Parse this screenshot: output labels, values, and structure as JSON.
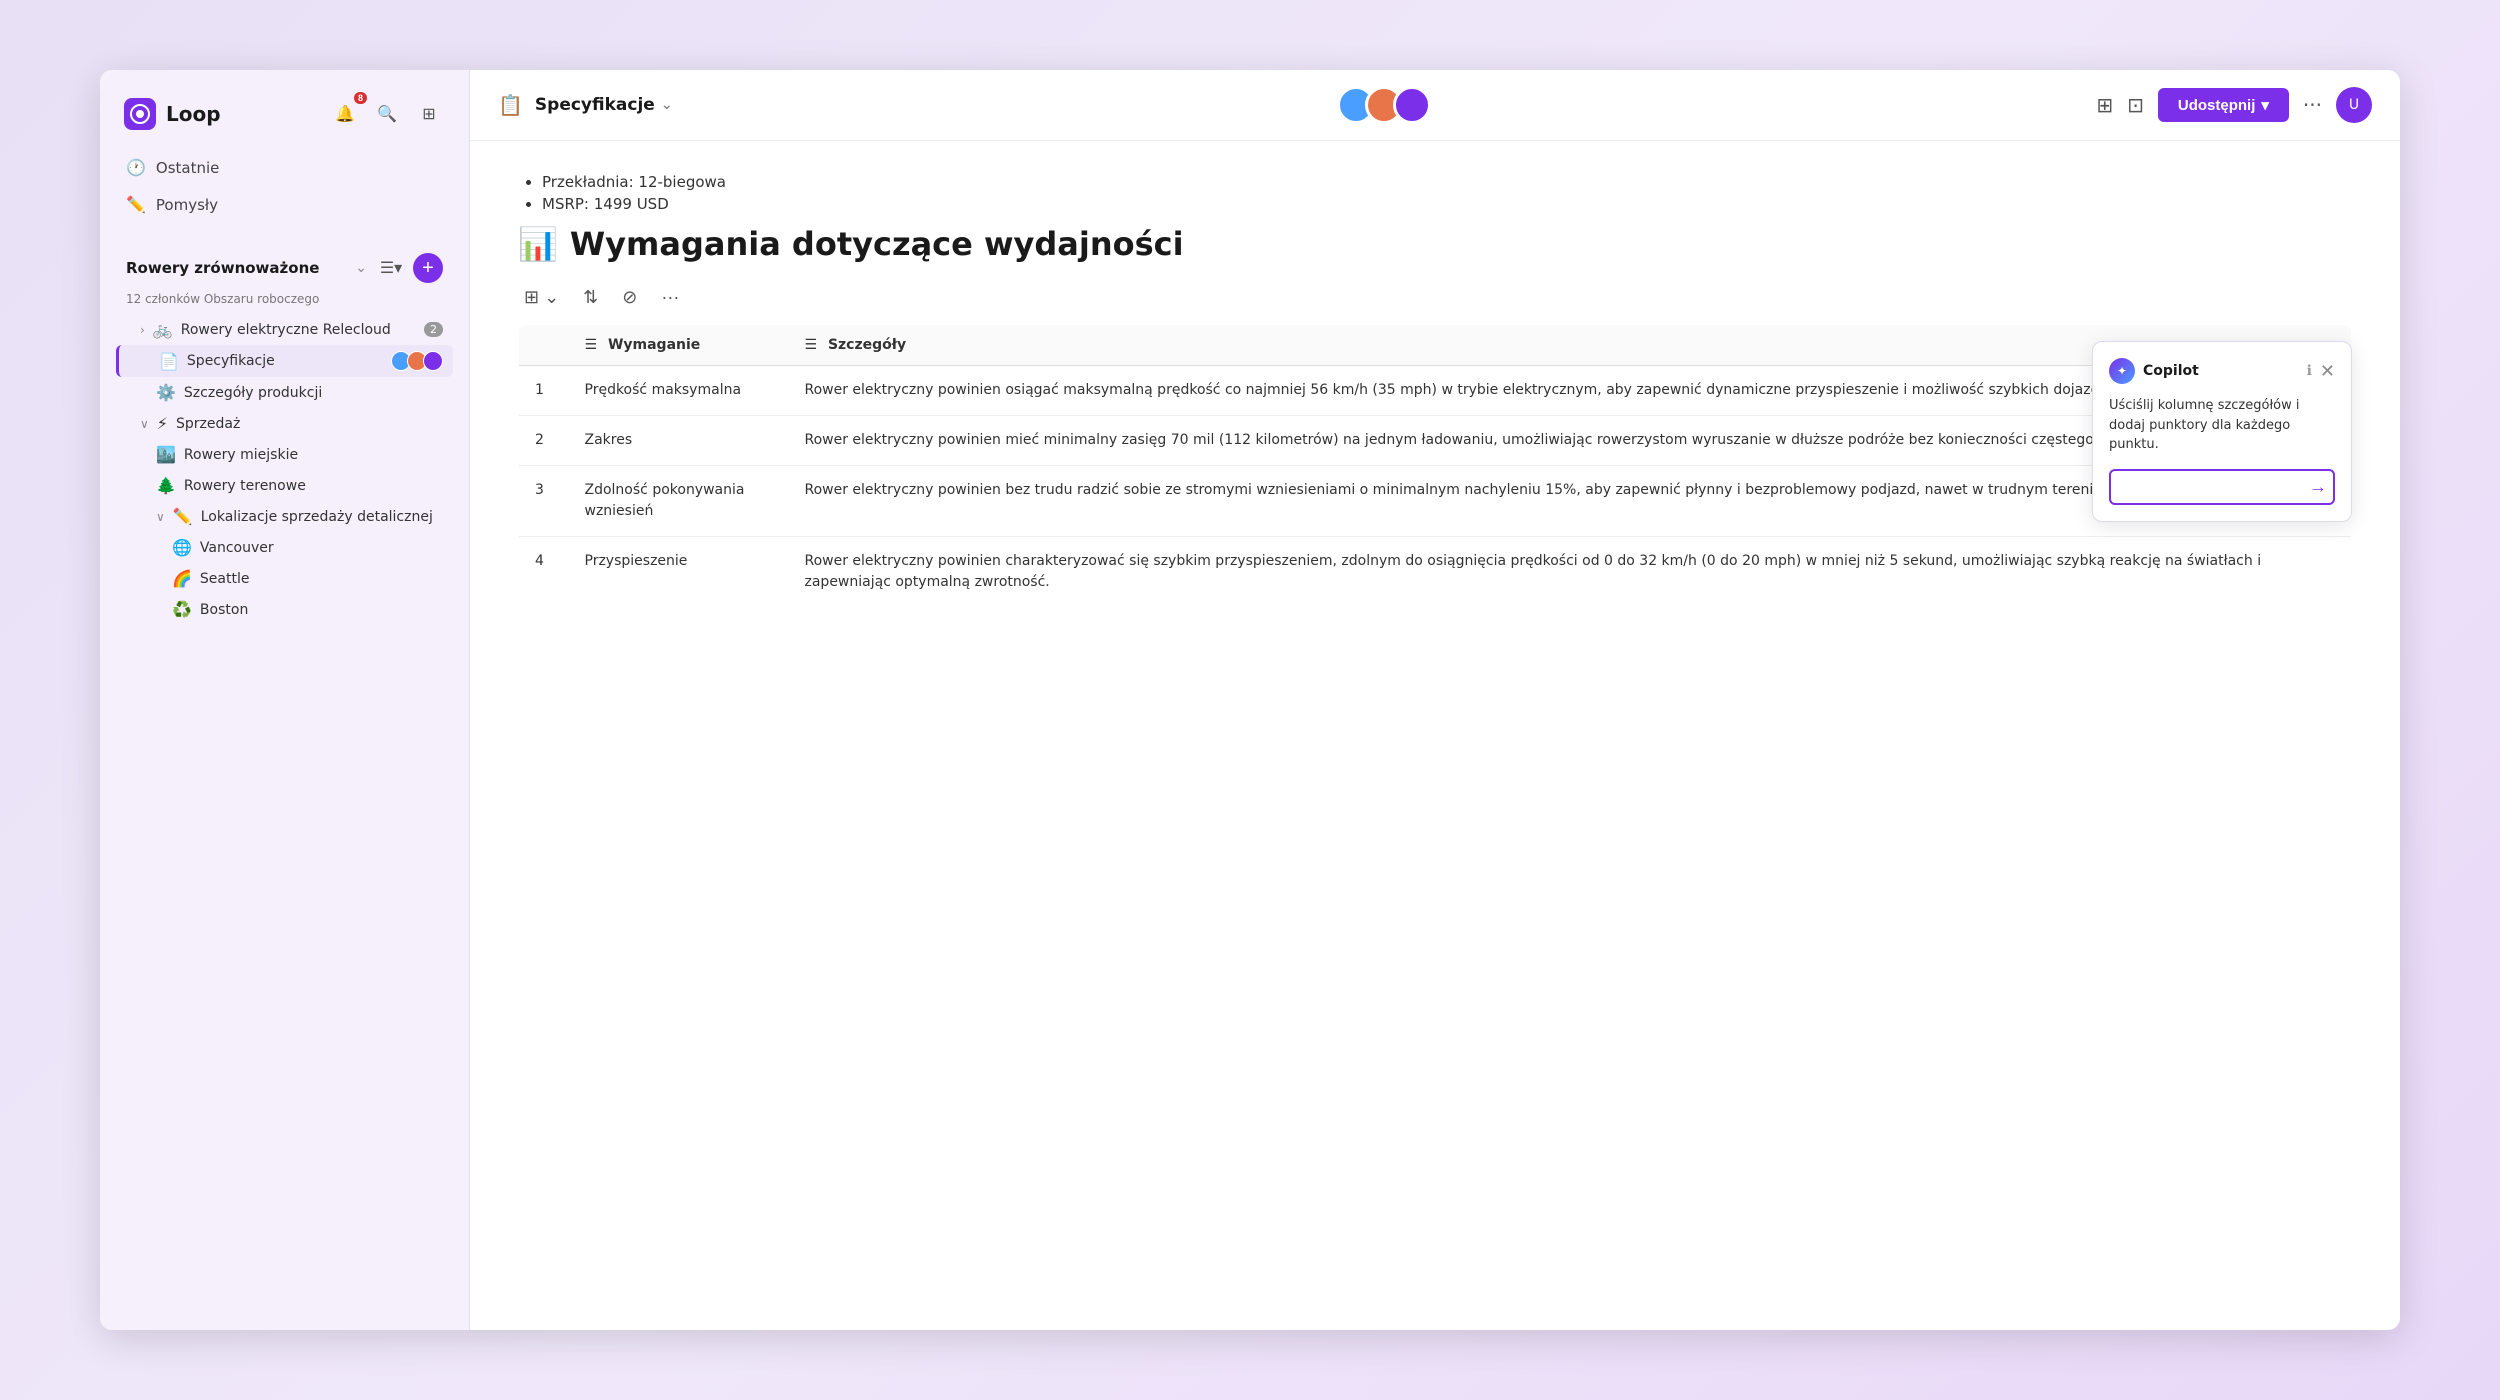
{
  "app": {
    "title": "Loop"
  },
  "sidebar": {
    "workspace": "Rowery zrównoważone",
    "workspace_subtitle": "12 członków Obszaru roboczego",
    "nav_items": [
      {
        "id": "ostatnie",
        "label": "Ostatnie",
        "icon": "🕐"
      },
      {
        "id": "pomysly",
        "label": "Pomysły",
        "icon": "✏️"
      }
    ],
    "tree": [
      {
        "id": "rowery-elektryczne",
        "label": "Rowery elektryczne Relecloud",
        "icon": "🚲",
        "indent": 1,
        "badge": "2",
        "collapsed": false
      },
      {
        "id": "specyfikacje",
        "label": "Specyfikacje",
        "icon": "📄",
        "indent": 2,
        "active": true
      },
      {
        "id": "szczegoly-produkcji",
        "label": "Szczegóły produkcji",
        "icon": "⚙️",
        "indent": 2
      },
      {
        "id": "sprzedaz",
        "label": "Sprzedaż",
        "icon": "⚡",
        "indent": 1,
        "collapsed": false
      },
      {
        "id": "rowery-miejskie",
        "label": "Rowery miejskie",
        "icon": "🏙️",
        "indent": 2
      },
      {
        "id": "rowery-terenowe",
        "label": "Rowery terenowe",
        "icon": "🌲",
        "indent": 2
      },
      {
        "id": "lokalizacje",
        "label": "Lokalizacje sprzedaży detalicznej",
        "icon": "✏️",
        "indent": 2,
        "collapsed": false
      },
      {
        "id": "vancouver",
        "label": "Vancouver",
        "icon": "🌐",
        "indent": 3
      },
      {
        "id": "seattle",
        "label": "Seattle",
        "icon": "🌈",
        "indent": 3
      },
      {
        "id": "boston",
        "label": "Boston",
        "icon": "♻️",
        "indent": 3
      }
    ],
    "plus_btn": "+",
    "bell_count": "8"
  },
  "topbar": {
    "page_icon": "📋",
    "page_title": "Specyfikacje",
    "share_label": "Udostępnij",
    "share_chevron": "▾"
  },
  "doc": {
    "bullets": [
      "Przekładnia: 12-biegowa",
      "MSRP: 1499 USD"
    ],
    "heading_icon": "📊",
    "heading": "Wymagania dotyczące wydajności",
    "table": {
      "cols": [
        "Wymaganie",
        "Szczegóły"
      ],
      "rows": [
        {
          "num": "1",
          "req": "Prędkość maksymalna",
          "detail": "Rower elektryczny powinien osiągać maksymalną prędkość co najmniej 56 km/h (35 mph) w trybie elektrycznym, aby zapewnić dynamiczne przyspieszenie i możliwość szybkich dojazdów do pracy."
        },
        {
          "num": "2",
          "req": "Zakres",
          "detail": "Rower elektryczny powinien mieć minimalny zasięg 70 mil (112 kilometrów) na jednym ładowaniu, umożliwiając rowerzystom wyruszanie w dłuższe podróże bez konieczności częstego ładowania."
        },
        {
          "num": "3",
          "req": "Zdolność pokonywania wzniesień",
          "detail": "Rower elektryczny powinien bez trudu radzić sobie ze stromymi wzniesieniami o minimalnym nachyleniu 15%, aby zapewnić płynny i bezproblemowy podjazd, nawet w trudnym terenie."
        },
        {
          "num": "4",
          "req": "Przyspieszenie",
          "detail": "Rower elektryczny powinien charakteryzować się szybkim przyspieszeniem, zdolnym do osiągnięcia prędkości od 0 do 32 km/h (0 do 20 mph) w mniej niż 5 sekund, umożliwiając szybką reakcję na światłach i zapewniając optymalną zwrotność."
        }
      ]
    }
  },
  "copilot": {
    "title": "Copilot",
    "info": "ℹ",
    "text": "Uściślij kolumnę szczegółów i dodaj punktory dla każdego punktu.",
    "input_placeholder": ""
  }
}
